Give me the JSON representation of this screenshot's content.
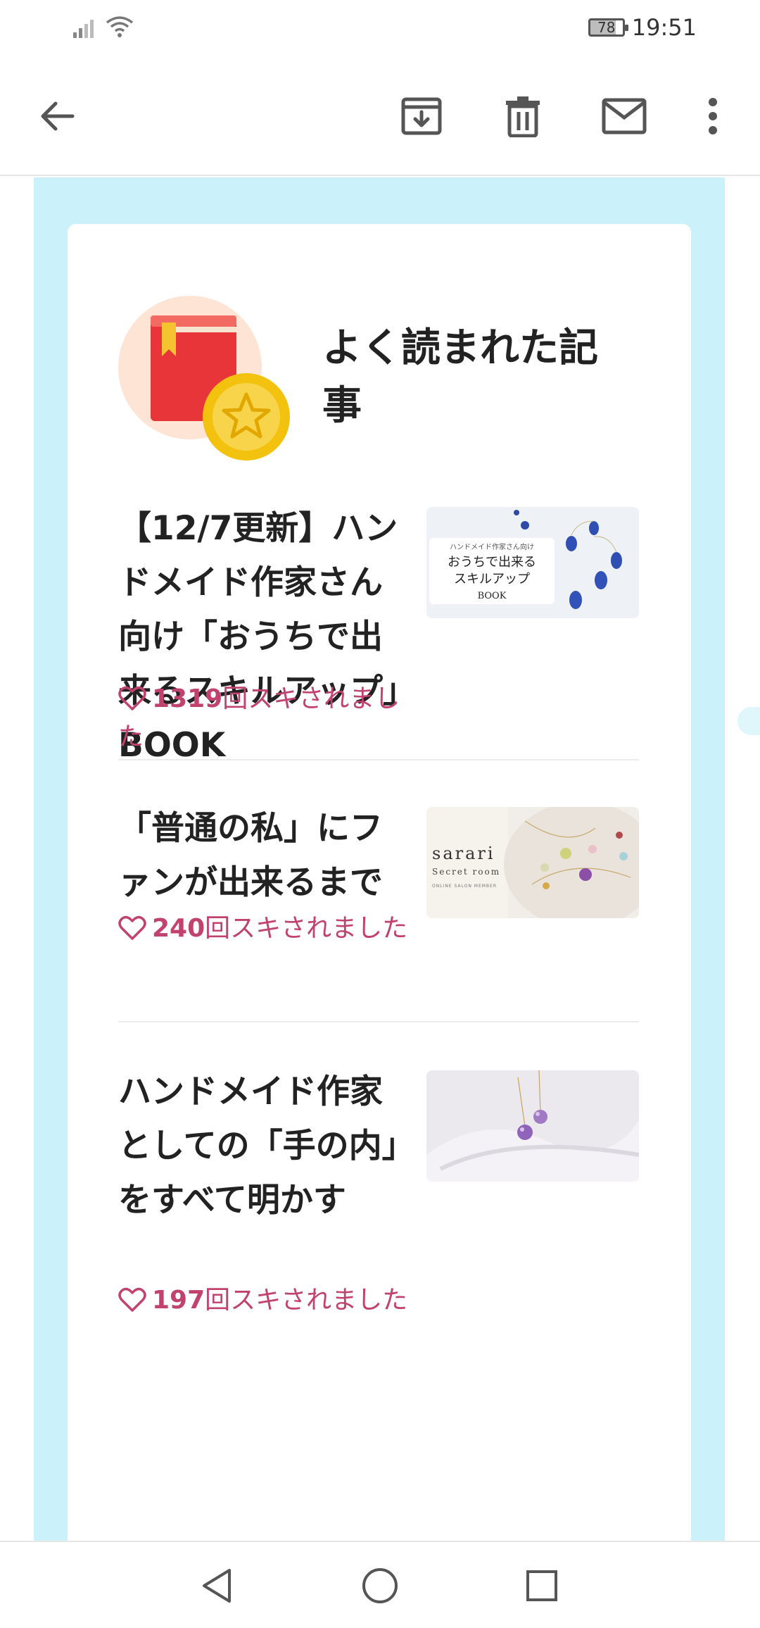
{
  "status_bar": {
    "time": "19:51",
    "battery": "78"
  },
  "toolbar": {
    "back_icon": "arrow-left",
    "archive_icon": "archive-download",
    "delete_icon": "trash",
    "mail_icon": "envelope",
    "more_icon": "more-vertical"
  },
  "card": {
    "title": "よく読まれた記事",
    "articles": [
      {
        "title": "【12/7更新】ハンドメイド作家さん向け「おうちで出来るスキルアップ」BOOK",
        "like_count": "1319",
        "like_suffix": "回スキされました",
        "thumb_caption_small": "ハンドメイド作家さん向け",
        "thumb_caption_line1": "おうちで出来る",
        "thumb_caption_line2": "スキルアップ",
        "thumb_caption_line3": "BOOK"
      },
      {
        "title": "「普通の私」にファンが出来るまで",
        "like_count": "240",
        "like_suffix": "回スキされました",
        "thumb_brand": "sarari",
        "thumb_sub": "Secret room",
        "thumb_tag": "ONLINE SALON MEMBER"
      },
      {
        "title": "ハンドメイド作家としての「手の内」をすべて明かす",
        "like_count": "197",
        "like_suffix": "回スキされました"
      }
    ]
  },
  "colors": {
    "accent_pink": "#c2426e",
    "panel_blue": "#cbf1fa"
  }
}
